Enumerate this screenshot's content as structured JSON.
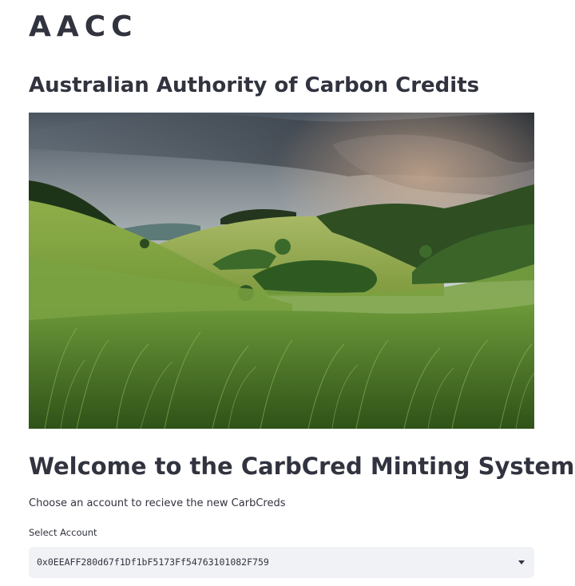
{
  "app": {
    "title": "AACC",
    "heading": "Australian Authority of Carbon Credits"
  },
  "hero": {
    "icon": "landscape-image"
  },
  "welcome": {
    "heading": "Welcome to the CarbCred Minting System",
    "instructions": "Choose an account to recieve the new CarbCreds"
  },
  "account_select": {
    "label": "Select Account",
    "selected_value": "0x0EEAFF280d67f1Df1bF5173Ff54763101082F759"
  },
  "colors": {
    "text": "#31333f",
    "select_background": "#f0f2f6"
  }
}
